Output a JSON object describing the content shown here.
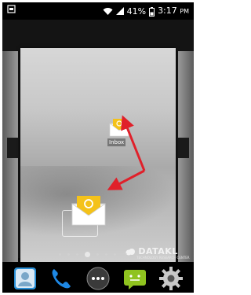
{
  "status_bar": {
    "battery_percent": "41%",
    "time": "3:17",
    "ampm": "PM"
  },
  "workspace": {
    "inbox_widget_label": "Inbox",
    "watermark": "DATAKL",
    "watermark_sub": "TECHNOLOGY RESEARCH CENTER",
    "page_indicator": {
      "count": 5,
      "active_index": 2
    }
  },
  "dock": {
    "items": [
      {
        "icon": "contacts-icon"
      },
      {
        "icon": "phone-icon"
      },
      {
        "icon": "app-drawer-icon"
      },
      {
        "icon": "messaging-icon"
      },
      {
        "icon": "settings-icon"
      }
    ]
  },
  "colors": {
    "arrow": "#e0202a",
    "envelope": "#f4c21a",
    "android_green": "#8fc31f",
    "phone_blue": "#1e88e5"
  }
}
